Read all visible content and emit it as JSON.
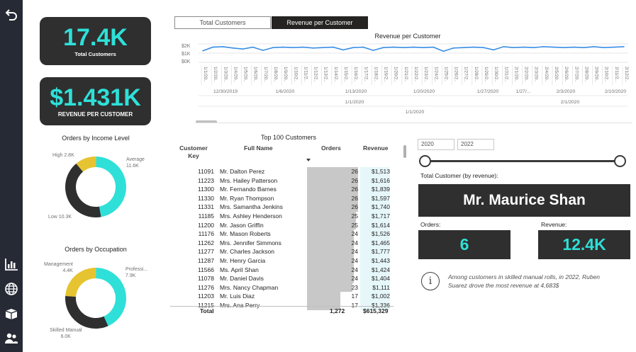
{
  "nav": {
    "items": [
      {
        "icon": "back-arrow-icon"
      },
      {
        "icon": "bar-chart-icon"
      },
      {
        "icon": "globe-icon"
      },
      {
        "icon": "box-icon"
      },
      {
        "icon": "users-icon"
      }
    ]
  },
  "kpis": {
    "total_customers": {
      "value": "17.4K",
      "label": "Total Customers"
    },
    "revenue_per_customer": {
      "value": "$1.431K",
      "label": "REVENUE PER CUSTOMER"
    }
  },
  "tabs": [
    {
      "label": "Total Customers",
      "active": false
    },
    {
      "label": "Revenue per Customer",
      "active": true
    }
  ],
  "line_chart": {
    "title": "Revenue per Customer",
    "y_ticks": [
      "$2K",
      "$1K",
      "$0K"
    ],
    "day_ticks": [
      "1/1/20..",
      "1/2/20..",
      "1/3/20..",
      "1/4/20..",
      "1/5/20..",
      "1/6/20..",
      "1/7/20..",
      "1/8/20..",
      "1/9/20..",
      "1/10/2..",
      "1/11/2..",
      "1/12/2..",
      "1/13/2..",
      "1/14/2..",
      "1/15/2..",
      "1/16/2..",
      "1/17/2..",
      "1/18/2..",
      "1/19/2..",
      "1/20/2..",
      "1/21/2..",
      "1/22/2..",
      "1/23/2..",
      "1/24/2..",
      "1/25/2..",
      "1/26/2..",
      "1/27/2..",
      "1/28/2..",
      "1/29/2..",
      "1/30/2..",
      "1/31/2..",
      "2/1/20..",
      "2/2/20..",
      "2/3/20..",
      "2/4/20..",
      "2/5/20..",
      "2/6/20..",
      "2/7/20..",
      "2/8/20..",
      "2/9/20..",
      "2/10/2..",
      "2/11/2..",
      "2/12/2.."
    ],
    "week_ticks": [
      "12/30/2019",
      "1/6/2020",
      "1/13/2020",
      "1/20/2020",
      "1/27/2020",
      "1/27/...",
      "2/3/2020",
      "2/10/2020"
    ],
    "month_ticks": [
      "1/1/2020",
      "2/1/2020"
    ],
    "year_ticks": [
      "1/1/2020"
    ]
  },
  "chart_data": [
    {
      "type": "line",
      "title": "Revenue per Customer",
      "ylim": [
        0,
        2000
      ],
      "x": [
        "1/1/2020",
        "1/2/2020",
        "1/3/2020",
        "1/4/2020",
        "1/5/2020",
        "1/6/2020",
        "1/7/2020",
        "1/8/2020",
        "1/9/2020",
        "1/10/2020",
        "1/11/2020",
        "1/12/2020",
        "1/13/2020",
        "1/14/2020",
        "1/15/2020",
        "1/16/2020",
        "1/17/2020",
        "1/18/2020",
        "1/19/2020",
        "1/20/2020",
        "1/21/2020",
        "1/22/2020",
        "1/23/2020",
        "1/24/2020",
        "1/25/2020",
        "1/26/2020",
        "1/27/2020",
        "1/28/2020",
        "1/29/2020",
        "1/30/2020",
        "1/31/2020",
        "2/1/2020",
        "2/2/2020",
        "2/3/2020",
        "2/4/2020",
        "2/5/2020",
        "2/6/2020",
        "2/7/2020",
        "2/8/2020",
        "2/9/2020",
        "2/10/2020",
        "2/11/2020",
        "2/12/2020"
      ],
      "values": [
        1250,
        1650,
        1700,
        1550,
        1450,
        1650,
        1300,
        1600,
        1650,
        1600,
        1650,
        1550,
        1600,
        1650,
        1350,
        1600,
        1650,
        1300,
        1600,
        1650,
        1600,
        1650,
        1600,
        1650,
        1200,
        1550,
        1600,
        1650,
        1600,
        1350,
        1700,
        1600,
        1650,
        1600,
        1700,
        1650,
        1600,
        1650,
        1600,
        1700,
        1600,
        1650,
        1700
      ]
    },
    {
      "type": "pie",
      "title": "Orders by Income Level",
      "categories": [
        "High",
        "Average",
        "Low"
      ],
      "values": [
        2800,
        11600,
        10300
      ],
      "labels": [
        "High 2.8K",
        "Average\n11.6K",
        "Low 10.3K"
      ],
      "colors": [
        "#e6c330",
        "#2ee0d8",
        "#2f2f2f"
      ]
    },
    {
      "type": "pie",
      "title": "Orders by Occupation",
      "categories": [
        "Management",
        "Professi...",
        "Skilled Manual"
      ],
      "values": [
        4400,
        7900,
        6000
      ],
      "labels": [
        "Management\n4.4K",
        "Professi...\n7.9K",
        "Skilled Manual\n6.0K"
      ],
      "colors": [
        "#e6c330",
        "#2ee0d8",
        "#2f2f2f"
      ]
    }
  ],
  "table": {
    "title": "Top 100 Customers",
    "columns": [
      "Customer\nKey",
      "Full Name",
      "Orders",
      "Revenue"
    ],
    "rows": [
      {
        "key": "11091",
        "name": "Mr. Dalton Perez",
        "orders": 26,
        "revenue": "$1,513"
      },
      {
        "key": "11223",
        "name": "Mrs. Hailey Patterson",
        "orders": 26,
        "revenue": "$1,616"
      },
      {
        "key": "11300",
        "name": "Mr. Fernando Barnes",
        "orders": 26,
        "revenue": "$1,839"
      },
      {
        "key": "11330",
        "name": "Mr. Ryan Thompson",
        "orders": 26,
        "revenue": "$1,597"
      },
      {
        "key": "11331",
        "name": "Mrs. Samantha Jenkins",
        "orders": 26,
        "revenue": "$1,740"
      },
      {
        "key": "11185",
        "name": "Mrs. Ashley Henderson",
        "orders": 25,
        "revenue": "$1,717"
      },
      {
        "key": "11200",
        "name": "Mr. Jason Griffin",
        "orders": 25,
        "revenue": "$1,614"
      },
      {
        "key": "11176",
        "name": "Mr. Mason Roberts",
        "orders": 24,
        "revenue": "$1,526"
      },
      {
        "key": "11262",
        "name": "Mrs. Jennifer Simmons",
        "orders": 24,
        "revenue": "$1,465"
      },
      {
        "key": "11277",
        "name": "Mr. Charles Jackson",
        "orders": 24,
        "revenue": "$1,777"
      },
      {
        "key": "11287",
        "name": "Mr. Henry Garcia",
        "orders": 24,
        "revenue": "$1,443"
      },
      {
        "key": "11566",
        "name": "Ms. April Shan",
        "orders": 24,
        "revenue": "$1,424"
      },
      {
        "key": "11078",
        "name": "Mr. Daniel Davis",
        "orders": 24,
        "revenue": "$1,404"
      },
      {
        "key": "11276",
        "name": "Mrs. Nancy Chapman",
        "orders": 23,
        "revenue": "$1,111"
      },
      {
        "key": "11203",
        "name": "Mr. Luis Diaz",
        "orders": 17,
        "revenue": "$1,002"
      },
      {
        "key": "11215",
        "name": "Mrs. Ana Perry",
        "orders": 17,
        "revenue": "$1,336"
      }
    ],
    "total": {
      "label": "Total",
      "orders": "1,272",
      "revenue": "$615,329"
    }
  },
  "filters": {
    "year_from": "2020",
    "year_to": "2022"
  },
  "top_customer": {
    "label": "Total Customer (by revenue):",
    "name": "Mr. Maurice Shan",
    "orders_label": "Orders:",
    "orders_value": "6",
    "revenue_label": "Revenue:",
    "revenue_value": "12.4K"
  },
  "info_note": {
    "icon": "info-icon",
    "text": "Among customers in skilled manual rolls, in 2022, Ruben Suarez drove the most revenue at 4,683$"
  },
  "colors": {
    "accent": "#2ee0d8",
    "gold": "#e6c330",
    "dark": "#2f2f2f",
    "line": "#3a8ee6"
  }
}
